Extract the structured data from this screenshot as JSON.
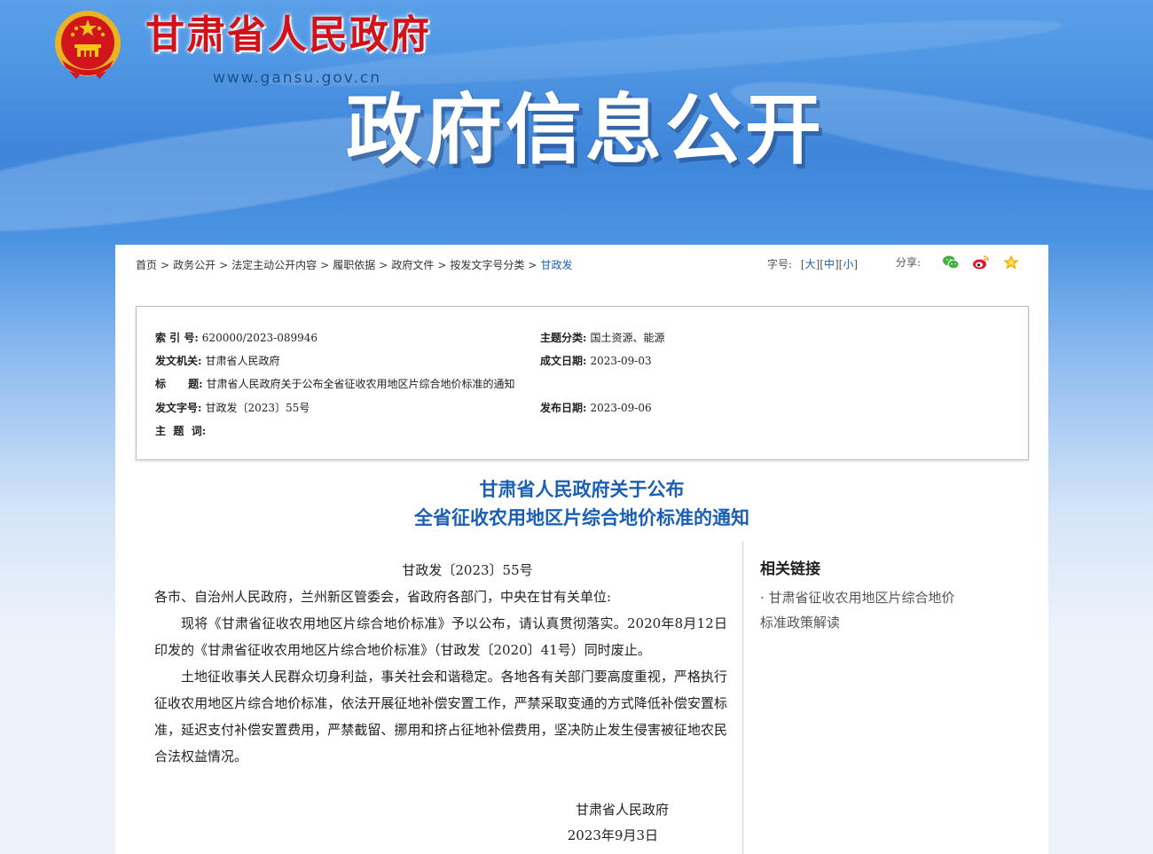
{
  "header": {
    "site_name": "甘肃省人民政府",
    "site_url": "www.gansu.gov.cn",
    "hero_title": "政府信息公开"
  },
  "breadcrumb": {
    "items": [
      "首页",
      "政务公开",
      "法定主动公开内容",
      "履职依据",
      "政府文件",
      "按发文字号分类"
    ],
    "current": "甘政发",
    "separator": ">"
  },
  "font_size": {
    "label": "字号:",
    "large": "大",
    "medium": "中",
    "small": "小"
  },
  "share": {
    "label": "分享:",
    "icons": [
      "wechat-icon",
      "weibo-icon",
      "favorite-star-icon"
    ]
  },
  "meta": {
    "index_label": "索  引  号:",
    "index_value": "620000/2023-089946",
    "topic_label": "主题分类:",
    "topic_value": "国土资源、能源",
    "issuer_label": "发文机关:",
    "issuer_value": "甘肃省人民政府",
    "written_label": "成文日期:",
    "written_value": "2023-09-03",
    "title_label": "标      题:",
    "title_value": "甘肃省人民政府关于公布全省征收农用地区片综合地价标准的通知",
    "docno_label": "发文字号:",
    "docno_value": "甘政发〔2023〕55号",
    "published_label": "发布日期:",
    "published_value": "2023-09-06",
    "keywords_label": "主  题  词:",
    "keywords_value": ""
  },
  "document": {
    "title_line1": "甘肃省人民政府关于公布",
    "title_line2": "全省征收农用地区片综合地价标准的通知",
    "doc_no": "甘政发〔2023〕55号",
    "addressee": "各市、自治州人民政府，兰州新区管委会，省政府各部门，中央在甘有关单位:",
    "para1": "现将《甘肃省征收农用地区片综合地价标准》予以公布，请认真贯彻落实。2020年8月12日印发的《甘肃省征收农用地区片综合地价标准》（甘政发〔2020〕41号）同时废止。",
    "para2": "土地征收事关人民群众切身利益，事关社会和谐稳定。各地各有关部门要高度重视，严格执行征收农用地区片综合地价标准，依法开展征地补偿安置工作，严禁采取变通的方式降低补偿安置标准，延迟支付补偿安置费用，严禁截留、挪用和挤占征地补偿费用，坚决防止发生侵害被征地农民合法权益情况。",
    "signer": "甘肃省人民政府",
    "sign_date": "2023年9月3日"
  },
  "related": {
    "title": "相关链接",
    "link_line1": "· 甘肃省征收农用地区片综合地价",
    "link_line2": "标准政策解读"
  },
  "colors": {
    "brand_red": "#d0121b",
    "link_blue": "#1a5fb4",
    "banner_blue": "#3f86db"
  }
}
